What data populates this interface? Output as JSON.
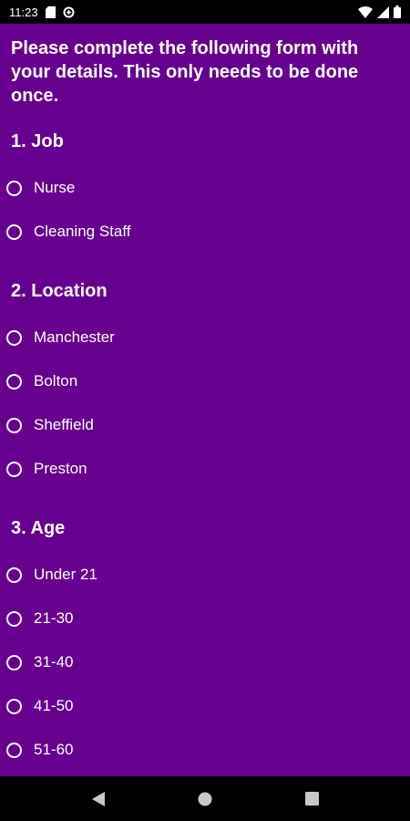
{
  "status_bar": {
    "time": "11:23"
  },
  "intro": "Please complete the following form with your details. This only needs to be done once.",
  "questions": [
    {
      "title": "1. Job",
      "options": [
        "Nurse",
        "Cleaning Staff"
      ]
    },
    {
      "title": "2. Location",
      "options": [
        "Manchester",
        "Bolton",
        "Sheffield",
        "Preston"
      ]
    },
    {
      "title": "3. Age",
      "options": [
        "Under 21",
        "21-30",
        "31-40",
        "41-50",
        "51-60"
      ]
    }
  ],
  "colors": {
    "background": "#66008f",
    "bars": "#000000",
    "text": "#ffffff"
  },
  "icons": {
    "status_left": [
      "sd-card-icon",
      "data-saver-icon"
    ],
    "status_right": [
      "wifi-icon",
      "cellular-signal-icon",
      "battery-icon"
    ],
    "nav": [
      "back-icon",
      "home-icon",
      "recents-icon"
    ]
  }
}
